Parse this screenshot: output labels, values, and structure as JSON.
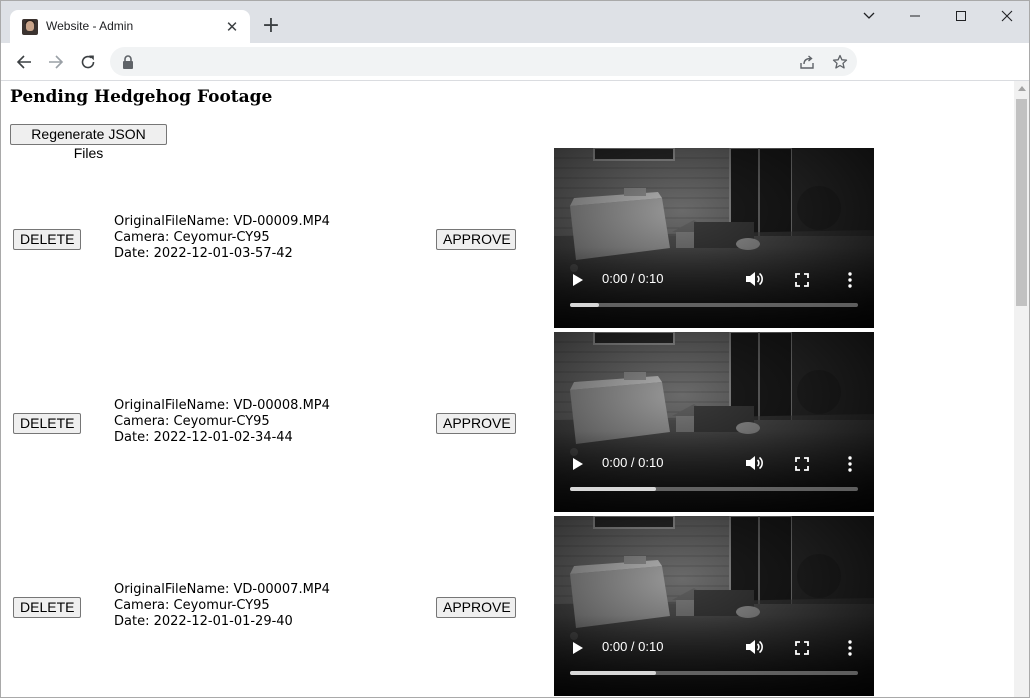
{
  "browser": {
    "tab": {
      "title": "Website - Admin",
      "close_glyph": "✕"
    },
    "new_tab_glyph": "+",
    "icons": [
      "back-arrow-icon",
      "forward-arrow-icon",
      "reload-icon",
      "lock-icon",
      "share-icon",
      "star-icon",
      "chevron-down-icon",
      "minimize-icon",
      "maximize-icon",
      "close-icon"
    ]
  },
  "page": {
    "title": "Pending Hedgehog Footage",
    "regenerate_label": "Regenerate JSON Files",
    "delete_label": "DELETE",
    "approve_label": "APPROVE",
    "entries": [
      {
        "filename": "OriginalFileName: VD-00009.MP4",
        "camera": "Camera: Ceyomur-CY95",
        "date": "Date: 2022-12-01-03-57-42",
        "time": "0:00 / 0:10",
        "buffered": 0.1
      },
      {
        "filename": "OriginalFileName: VD-00008.MP4",
        "camera": "Camera: Ceyomur-CY95",
        "date": "Date: 2022-12-01-02-34-44",
        "time": "0:00 / 0:10",
        "buffered": 0.3
      },
      {
        "filename": "OriginalFileName: VD-00007.MP4",
        "camera": "Camera: Ceyomur-CY95",
        "date": "Date: 2022-12-01-01-29-40",
        "time": "0:00 / 0:10",
        "buffered": 0.3
      }
    ]
  },
  "colors": {
    "tabstrip": "#dee1e6",
    "omnibox": "#f1f3f4",
    "button_bg": "#efefef",
    "button_border": "#767676"
  }
}
